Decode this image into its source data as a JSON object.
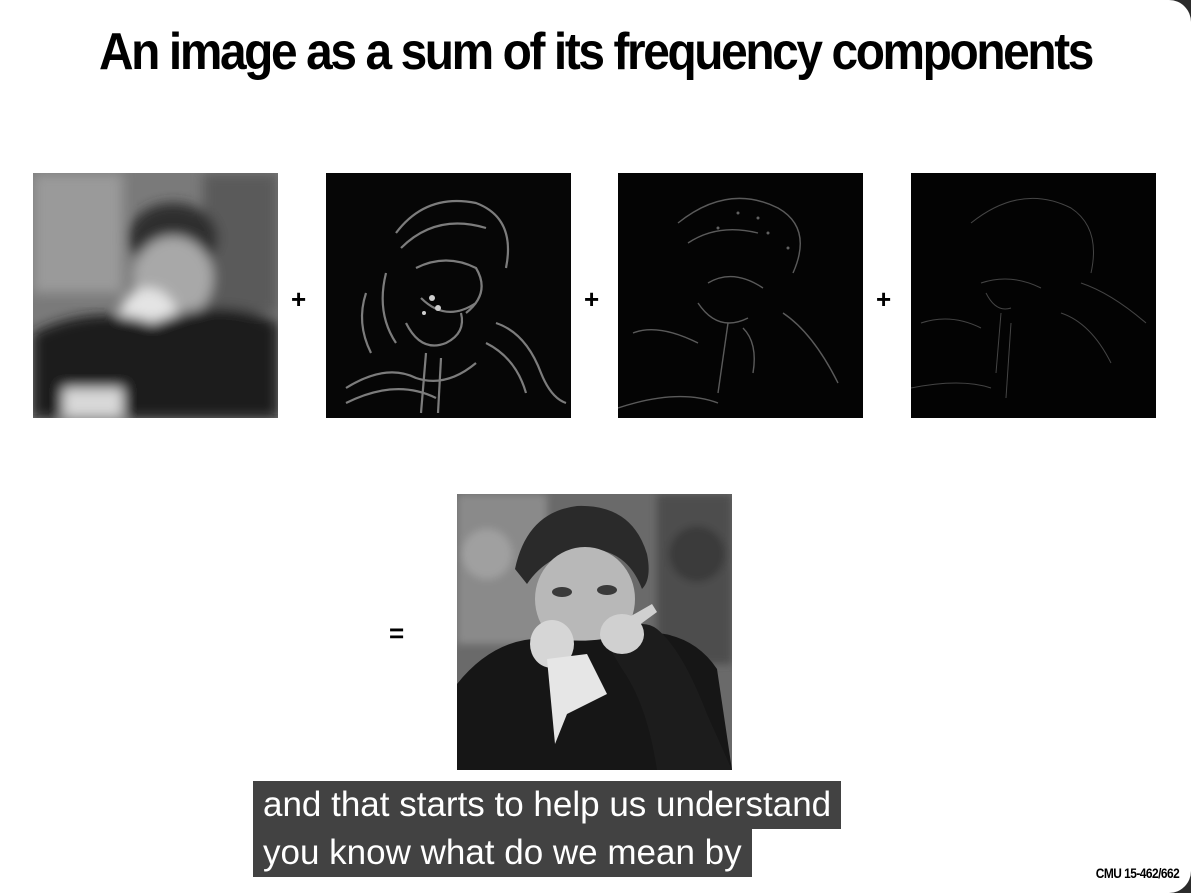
{
  "slide": {
    "title": "An image as a sum of its frequency components",
    "operators": {
      "plus": "+",
      "equals": "="
    },
    "course_label": "CMU 15-462/662"
  },
  "images": {
    "components": [
      {
        "name": "low-frequency-component"
      },
      {
        "name": "mid-low-frequency-component"
      },
      {
        "name": "mid-high-frequency-component"
      },
      {
        "name": "high-frequency-component"
      }
    ],
    "result": {
      "name": "original-photo"
    }
  },
  "captions": {
    "line1": "and that starts to help us understand",
    "line2": "you know what do we mean by"
  },
  "colors": {
    "slide_bg": "#ffffff",
    "caption_bg": "#282828",
    "caption_text": "#ffffff"
  }
}
